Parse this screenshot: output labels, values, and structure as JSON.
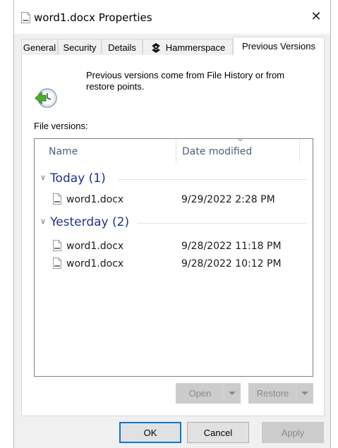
{
  "window": {
    "title": "word1.docx Properties",
    "close_glyph": "✕"
  },
  "tabs": [
    {
      "label": "General",
      "active": false
    },
    {
      "label": "Security",
      "active": false
    },
    {
      "label": "Details",
      "active": false
    },
    {
      "label": "Hammerspace",
      "active": false,
      "icon": "hammerspace-logo-icon"
    },
    {
      "label": "Previous Versions",
      "active": true
    }
  ],
  "info": {
    "icon": "file-history-clock-icon",
    "text": "Previous versions come from File History or from restore points."
  },
  "file_versions": {
    "label": "File versions:",
    "columns": {
      "name": "Name",
      "date": "Date modified"
    },
    "groups": [
      {
        "title": "Today (1)",
        "items": [
          {
            "name": "word1.docx",
            "date": "9/29/2022 2:28 PM"
          }
        ]
      },
      {
        "title": "Yesterday (2)",
        "items": [
          {
            "name": "word1.docx",
            "date": "9/28/2022 11:18 PM"
          },
          {
            "name": "word1.docx",
            "date": "9/28/2022 10:12 PM"
          }
        ]
      }
    ]
  },
  "actions": {
    "open": "Open",
    "restore": "Restore"
  },
  "dialog_buttons": {
    "ok": "OK",
    "cancel": "Cancel",
    "apply": "Apply"
  },
  "colors": {
    "group_header": "#1e3287",
    "accent_focus": "#0078d7",
    "column_header": "#4c607a"
  }
}
